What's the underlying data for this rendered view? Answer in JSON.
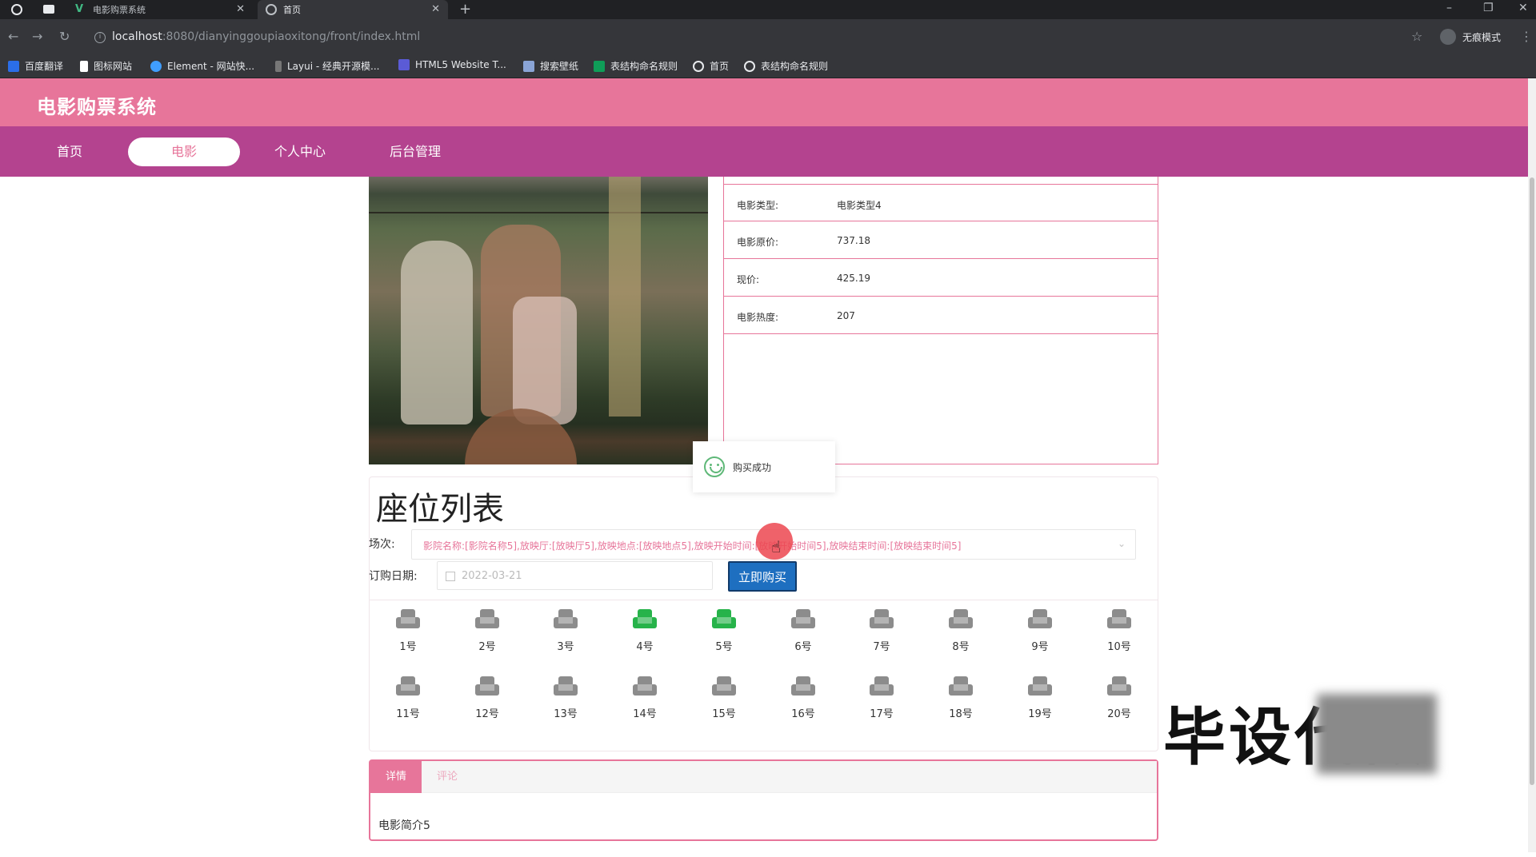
{
  "browser": {
    "tabs": [
      {
        "title": "电影购票系统"
      },
      {
        "title": "首页"
      }
    ],
    "url_host": "localhost",
    "url_path": ":8080/dianyinggoupiaoxitong/front/index.html",
    "profile_label": "无痕模式",
    "bookmarks": [
      {
        "label": "百度翻译",
        "color": "#2b6ee8"
      },
      {
        "label": "图标网站",
        "color": "#ffffff"
      },
      {
        "label": "Element - 网站快...",
        "color": "#409eff"
      },
      {
        "label": "Layui - 经典开源模...",
        "color": "#cccccc"
      },
      {
        "label": "HTML5 Website T...",
        "color": "#5b5bd6"
      },
      {
        "label": "搜索壁纸",
        "color": "#8aa4d6"
      },
      {
        "label": "表结构命名规则",
        "color": "#0f9d58"
      },
      {
        "label": "首页",
        "color": "#e8eaed"
      },
      {
        "label": "表结构命名规则",
        "color": "#e8eaed"
      }
    ]
  },
  "site": {
    "title": "电影购票系统",
    "nav": [
      {
        "label": "首页",
        "active": false
      },
      {
        "label": "电影",
        "active": true
      },
      {
        "label": "个人中心",
        "active": false
      },
      {
        "label": "后台管理",
        "active": false
      }
    ]
  },
  "movie": {
    "details": [
      {
        "key": "电影类型:",
        "value": "电影类型4"
      },
      {
        "key": "电影原价:",
        "value": "737.18"
      },
      {
        "key": "现价:",
        "value": "425.19"
      },
      {
        "key": "电影热度:",
        "value": "207"
      }
    ]
  },
  "toast": {
    "message": "购买成功"
  },
  "booking": {
    "title": "座位列表",
    "session_label": "场次:",
    "session_value": "影院名称:[影院名称5],放映厅:[放映厅5],放映地点:[放映地点5],放映开始时间:[放映开始时间5],放映结束时间:[放映结束时间5]",
    "date_label": "订购日期:",
    "date_placeholder": "2022-03-21",
    "buy_label": "立即购买"
  },
  "seats": [
    {
      "label": "1号",
      "taken": false
    },
    {
      "label": "2号",
      "taken": false
    },
    {
      "label": "3号",
      "taken": false
    },
    {
      "label": "4号",
      "taken": true
    },
    {
      "label": "5号",
      "taken": true
    },
    {
      "label": "6号",
      "taken": false
    },
    {
      "label": "7号",
      "taken": false
    },
    {
      "label": "8号",
      "taken": false
    },
    {
      "label": "9号",
      "taken": false
    },
    {
      "label": "10号",
      "taken": false
    },
    {
      "label": "11号",
      "taken": false
    },
    {
      "label": "12号",
      "taken": false
    },
    {
      "label": "13号",
      "taken": false
    },
    {
      "label": "14号",
      "taken": false
    },
    {
      "label": "15号",
      "taken": false
    },
    {
      "label": "16号",
      "taken": false
    },
    {
      "label": "17号",
      "taken": false
    },
    {
      "label": "18号",
      "taken": false
    },
    {
      "label": "19号",
      "taken": false
    },
    {
      "label": "20号",
      "taken": false
    }
  ],
  "info_tabs": {
    "tabs": [
      {
        "label": "详情"
      },
      {
        "label": "评论"
      }
    ],
    "content": "电影简介5"
  },
  "watermark": {
    "text": "毕设代做"
  }
}
